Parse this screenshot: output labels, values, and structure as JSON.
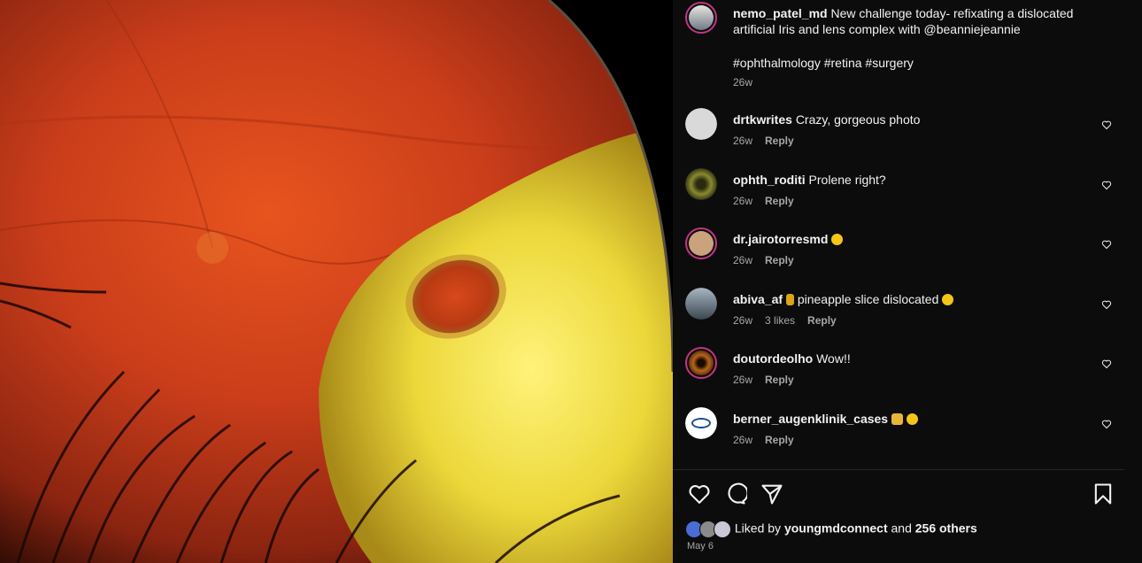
{
  "post": {
    "author": "nemo_patel_md",
    "caption": "New challenge today- refixating a dislocated artificial Iris and lens complex with @beanniejeannie",
    "hashtags": "#ophthalmology #retina #surgery",
    "time": "26w"
  },
  "comments": [
    {
      "user": "drtkwrites",
      "text": "Crazy, gorgeous photo",
      "time": "26w",
      "likes": "",
      "reply": "Reply",
      "avatar_color": "#d9d9d9"
    },
    {
      "user": "ophth_roditi",
      "text": "Prolene right?",
      "time": "26w",
      "likes": "",
      "reply": "Reply",
      "avatar_color": "#7a7a2a"
    },
    {
      "user": "dr.jairotorresmd",
      "text": "",
      "emoji": "smile",
      "time": "26w",
      "likes": "",
      "reply": "Reply",
      "avatar_color": "#caa27c"
    },
    {
      "user": "abiva_af",
      "text": "pineapple slice dislocated",
      "emoji": "pineapple-wow",
      "time": "26w",
      "likes": "3 likes",
      "reply": "Reply",
      "avatar_color": "#5a6d7c"
    },
    {
      "user": "doutordeolho",
      "text": "Wow!!",
      "time": "26w",
      "likes": "",
      "reply": "Reply",
      "avatar_color": "#a0521d"
    },
    {
      "user": "berner_augenklinik_cases",
      "text": "",
      "emoji": "clap-wow",
      "time": "26w",
      "likes": "",
      "reply": "Reply",
      "avatar_color": "#ffffff"
    }
  ],
  "likes_bar": {
    "prefix": "Liked by",
    "user": "youngmdconnect",
    "and": "and",
    "others": "256 others"
  },
  "date": "May 6",
  "icons": [
    "heart-icon",
    "comment-icon",
    "share-icon",
    "bookmark-icon"
  ],
  "colors": {
    "accent_ring": "#c13584",
    "muted": "#a8a8a8",
    "panel_bg": "#0c0c0c"
  }
}
